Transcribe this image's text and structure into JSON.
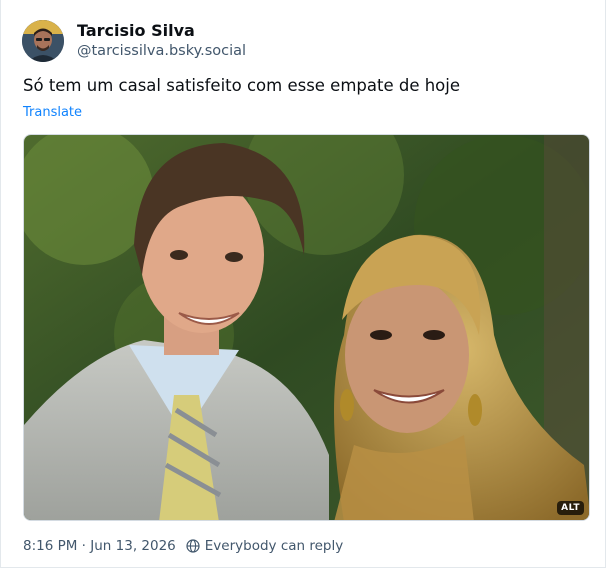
{
  "author": {
    "display_name": "Tarcisio Silva",
    "handle": "@tarcissilva.bsky.social",
    "avatar_icon": "user-avatar-photo"
  },
  "post": {
    "text": "Só tem um casal satisfeito com esse empate de hoje",
    "translate_label": "Translate",
    "media": {
      "alt_badge": "ALT",
      "image_icon": "couple-photo"
    },
    "timestamp": "8:16 PM · Jun 13, 2026",
    "reply_setting_label": "Everybody can reply",
    "reply_setting_icon": "globe-icon"
  },
  "colors": {
    "link": "#1083fe",
    "muted_text": "#42576c",
    "border": "#e3e8ec"
  }
}
